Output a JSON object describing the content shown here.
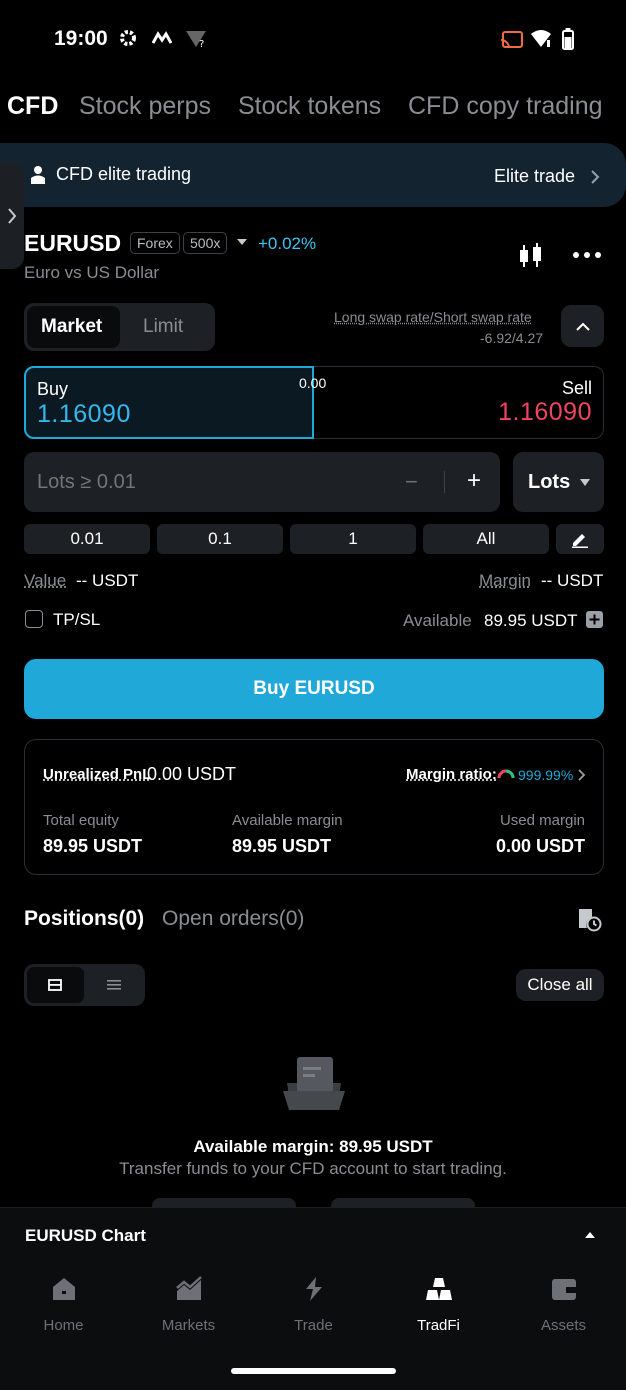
{
  "status": {
    "time": "19:00"
  },
  "tabs": [
    "CFD",
    "Stock perps",
    "Stock tokens",
    "CFD copy trading"
  ],
  "banner": {
    "left": "CFD elite trading",
    "right": "Elite trade"
  },
  "instrument": {
    "symbol": "EURUSD",
    "category": "Forex",
    "leverage": "500x",
    "change": "+0.02%",
    "name": "Euro vs US Dollar"
  },
  "order_type": {
    "market": "Market",
    "limit": "Limit"
  },
  "swap": {
    "label": "Long swap rate/Short swap rate",
    "value": "-6.92/4.27"
  },
  "quote": {
    "buy_label": "Buy",
    "buy_price": "1.16090",
    "spread": "0.00",
    "sell_label": "Sell",
    "sell_price": "1.16090"
  },
  "lots": {
    "placeholder": "Lots ≥ 0.01",
    "unit": "Lots",
    "minus": "−",
    "plus": "+"
  },
  "quick_amounts": [
    "0.01",
    "0.1",
    "1",
    "All"
  ],
  "value_row": {
    "value_label": "Value",
    "value": "-- USDT",
    "margin_label": "Margin",
    "margin": "-- USDT"
  },
  "tpsl": {
    "label": "TP/SL",
    "available_label": "Available",
    "available": "89.95 USDT"
  },
  "cta": "Buy EURUSD",
  "summary": {
    "pnl_label": "Unrealized PnL",
    "pnl": "0.00 USDT",
    "margin_ratio_label": "Margin ratio:",
    "margin_ratio": "999.99%",
    "total_equity_label": "Total equity",
    "total_equity": "89.95 USDT",
    "available_margin_label": "Available margin",
    "available_margin": "89.95 USDT",
    "used_margin_label": "Used margin",
    "used_margin": "0.00 USDT"
  },
  "positions": {
    "positions_tab": "Positions(0)",
    "orders_tab": "Open orders(0)",
    "close_all": "Close all"
  },
  "empty": {
    "title": "Available margin: 89.95 USDT",
    "subtitle": "Transfer funds to your CFD account to start trading."
  },
  "chart_bar": {
    "label": "EURUSD Chart"
  },
  "nav": [
    {
      "label": "Home",
      "icon": "home-icon"
    },
    {
      "label": "Markets",
      "icon": "markets-icon"
    },
    {
      "label": "Trade",
      "icon": "trade-icon"
    },
    {
      "label": "TradFi",
      "icon": "tradfi-icon"
    },
    {
      "label": "Assets",
      "icon": "assets-icon"
    }
  ],
  "colors": {
    "accent": "#1fa8d8",
    "buy": "#35b8ee",
    "sell": "#f0445f",
    "change": "#3cc6f0"
  }
}
